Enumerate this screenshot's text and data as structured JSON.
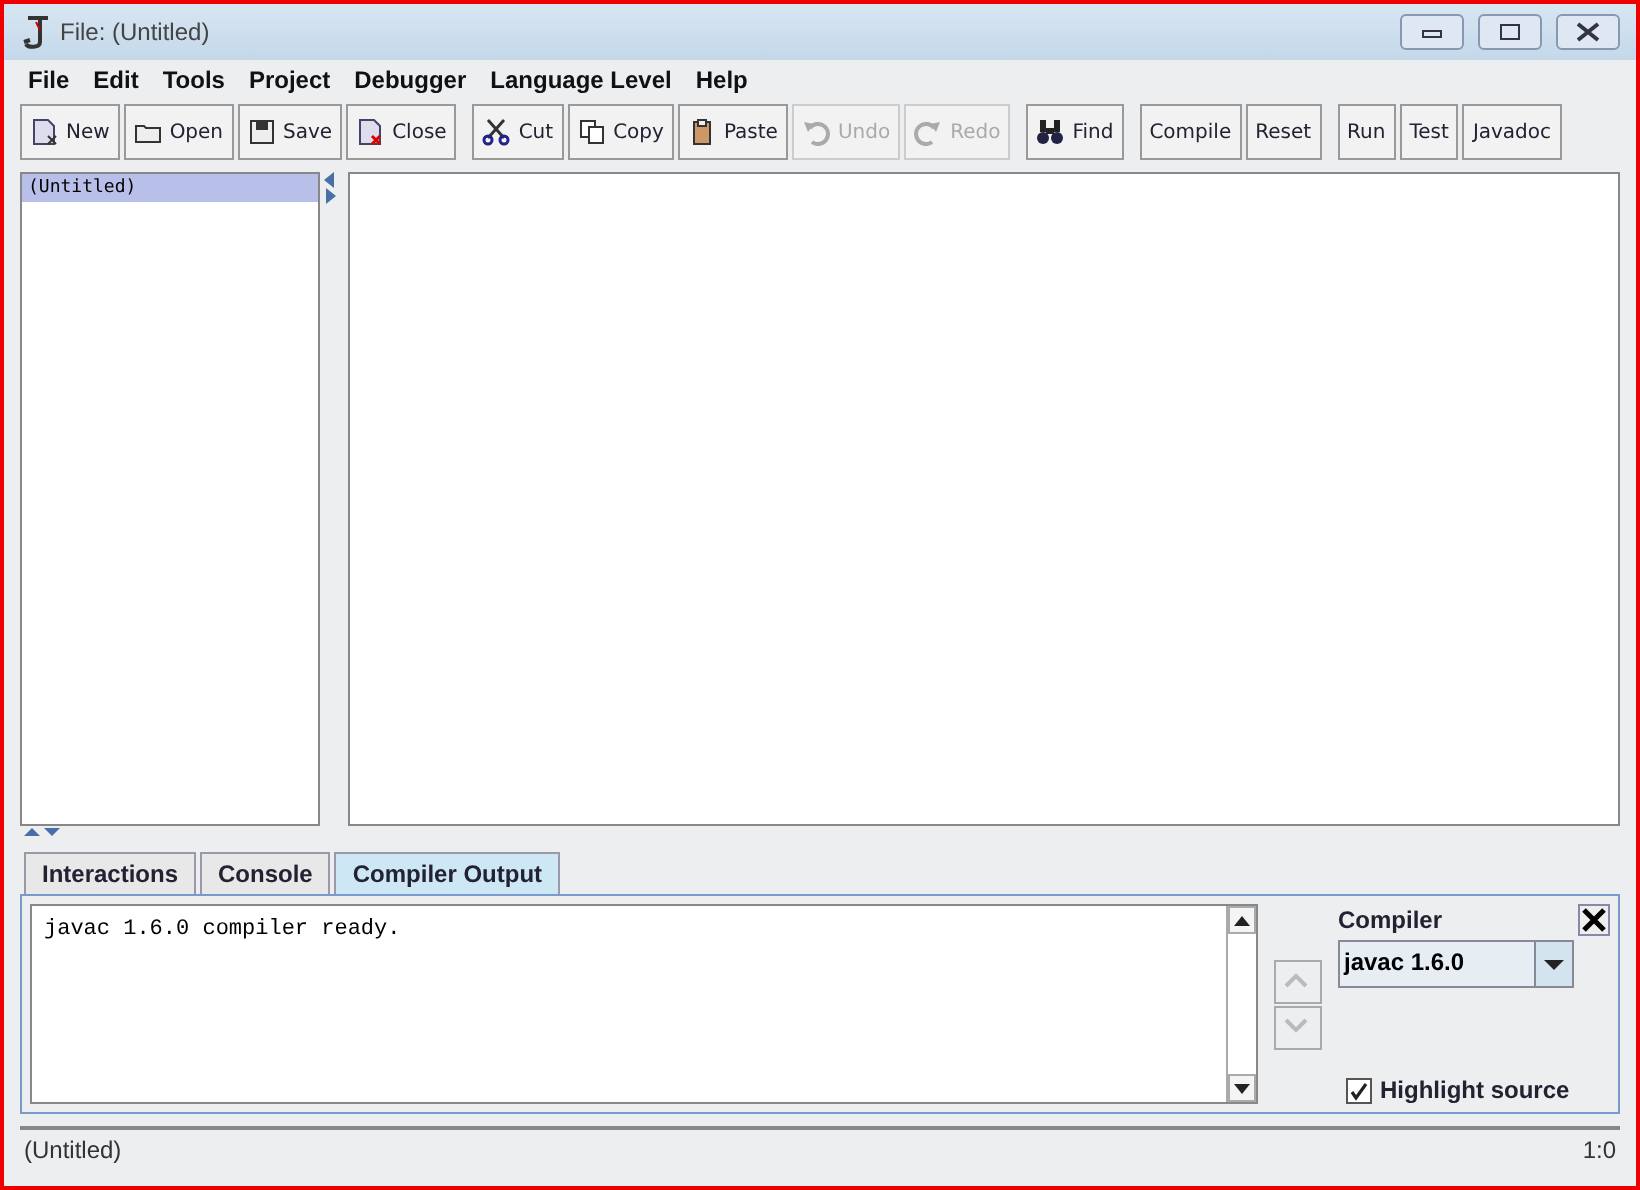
{
  "window": {
    "title": "File: (Untitled)"
  },
  "menu": [
    "File",
    "Edit",
    "Tools",
    "Project",
    "Debugger",
    "Language Level",
    "Help"
  ],
  "toolbar": [
    [
      {
        "kind": "new",
        "label": "New",
        "disabled": false
      },
      {
        "kind": "open",
        "label": "Open",
        "disabled": false
      },
      {
        "kind": "save",
        "label": "Save",
        "disabled": false
      },
      {
        "kind": "close",
        "label": "Close",
        "disabled": false
      }
    ],
    [
      {
        "kind": "cut",
        "label": "Cut",
        "disabled": false
      },
      {
        "kind": "copy",
        "label": "Copy",
        "disabled": false
      },
      {
        "kind": "paste",
        "label": "Paste",
        "disabled": false
      },
      {
        "kind": "undo",
        "label": "Undo",
        "disabled": true
      },
      {
        "kind": "redo",
        "label": "Redo",
        "disabled": true
      }
    ],
    [
      {
        "kind": "find",
        "label": "Find",
        "disabled": false
      }
    ],
    [
      {
        "kind": "text",
        "label": "Compile",
        "disabled": false
      },
      {
        "kind": "text",
        "label": "Reset",
        "disabled": false
      }
    ],
    [
      {
        "kind": "text",
        "label": "Run",
        "disabled": false
      },
      {
        "kind": "text",
        "label": "Test",
        "disabled": false
      },
      {
        "kind": "text",
        "label": "Javadoc",
        "disabled": false
      }
    ]
  ],
  "documents": [
    {
      "name": "(Untitled)",
      "selected": true
    }
  ],
  "tabs": [
    {
      "label": "Interactions",
      "selected": false
    },
    {
      "label": "Console",
      "selected": false
    },
    {
      "label": "Compiler Output",
      "selected": true
    }
  ],
  "output": {
    "text": "javac 1.6.0 compiler ready."
  },
  "compiler_panel": {
    "label": "Compiler",
    "value": "javac 1.6.0",
    "highlight": {
      "label": "Highlight source",
      "checked": true
    }
  },
  "status_bar": {
    "file": "(Untitled)",
    "position": "1:0"
  }
}
